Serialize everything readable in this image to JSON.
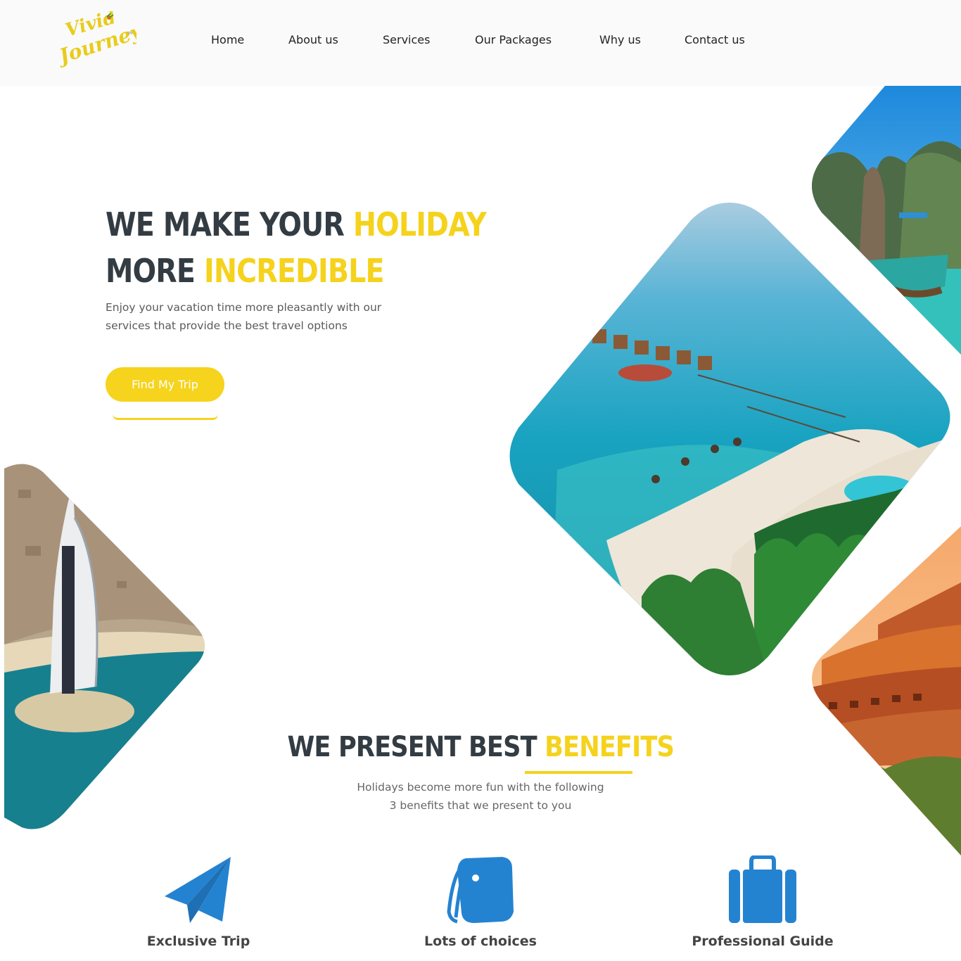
{
  "brand": {
    "logo_text_1": "Vivid",
    "logo_text_2": "Journeys",
    "logo_tm": "TM",
    "color_accent": "#f5d21c",
    "color_dark": "#333c43",
    "color_icon": "#2483d1"
  },
  "nav": {
    "items": [
      {
        "label": "Home"
      },
      {
        "label": "About us"
      },
      {
        "label": "Services"
      },
      {
        "label": "Our Packages"
      },
      {
        "label": "Why us"
      },
      {
        "label": "Contact us"
      }
    ]
  },
  "hero": {
    "title_part1": "WE MAKE YOUR ",
    "title_highlight1": "HOLIDAY",
    "title_part2": "MORE ",
    "title_highlight2": "INCREDIBLE",
    "description": "Enjoy your vacation time more pleasantly with our services that provide the best travel options",
    "cta_label": "Find My Trip"
  },
  "benefits": {
    "title_part1": "WE PRESENT BEST ",
    "title_highlight": "BENEFITS",
    "subtitle_line1": "Holidays become more fun with the following",
    "subtitle_line2": "3 benefits that we present to you",
    "items": [
      {
        "label": "Exclusive Trip",
        "icon": "paper-plane-icon"
      },
      {
        "label": "Lots of choices",
        "icon": "tags-icon"
      },
      {
        "label": "Professional Guide",
        "icon": "suitcase-icon"
      }
    ]
  }
}
